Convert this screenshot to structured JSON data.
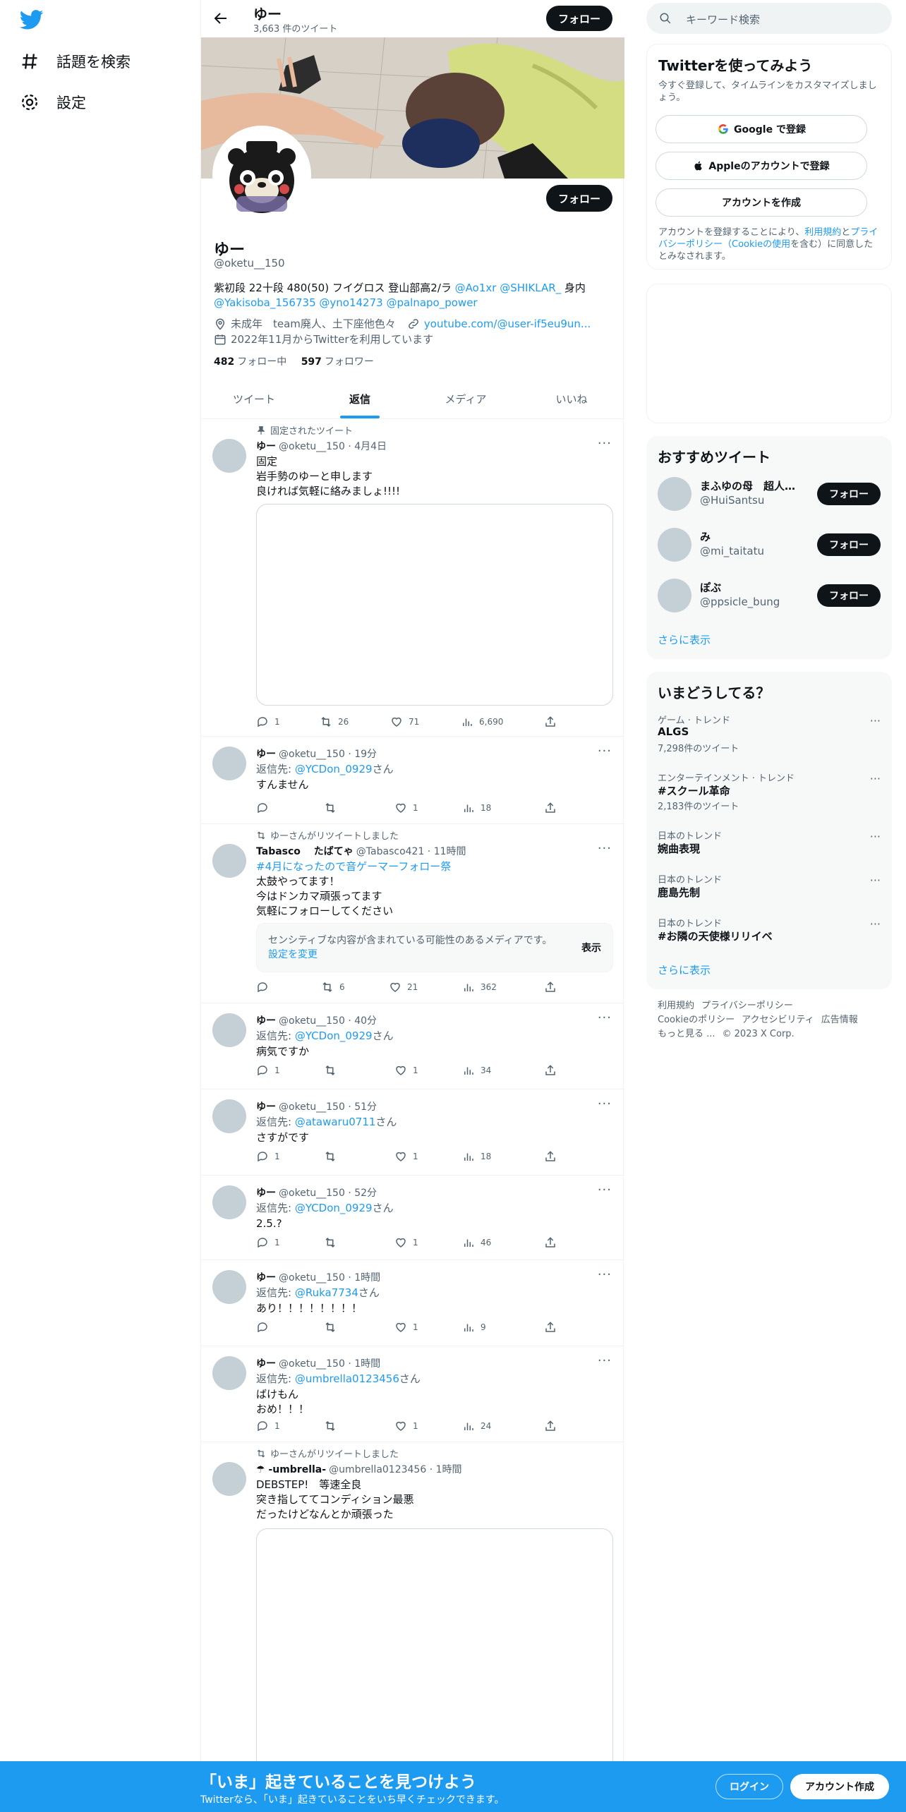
{
  "colors": {
    "accent": "#1d9bf0",
    "dark": "#0f1419",
    "muted": "#536471"
  },
  "nav": {
    "explore": "話題を検索",
    "settings": "設定"
  },
  "header": {
    "name": "ゆー",
    "tweet_count": "3,663 件のツイート",
    "follow": "フォロー"
  },
  "profile": {
    "follow": "フォロー",
    "name": "ゆー",
    "handle": "@oketu__150",
    "bio_line1_text": "紫初段 22十段 480(50) フイグロス 登山部高2/ラ ",
    "bio_link1": "@Ao1xr",
    "bio_link2": "@SHIKLAR_",
    "bio_line1_tail": " 身内",
    "bio_link3": "@Yakisoba_156735",
    "bio_link4": "@yno14273",
    "bio_link5": "@palnapo_power",
    "location": "未成年　team廃人、土下座他色々",
    "url": "youtube.com/@user-if5eu9un...",
    "joined": "2022年11月からTwitterを利用しています",
    "following_count": "482",
    "following_label": "フォロー中",
    "followers_count": "597",
    "followers_label": "フォロワー"
  },
  "tabs": [
    "ツイート",
    "返信",
    "メディア",
    "いいね"
  ],
  "tweets": [
    {
      "context": "固定されたツイート",
      "name": "ゆー",
      "meta": "@oketu__150 · 4月4日",
      "text": "固定\n岩手勢のゆーと申します\n良ければ気軽に絡みましょ!!!!",
      "reply": "1",
      "rt": "26",
      "like": "71",
      "views": "6,690"
    },
    {
      "name": "ゆー",
      "meta": "@oketu__150 · 19分",
      "reply_prefix": "返信先: ",
      "reply_to": "@YCDon_0929",
      "reply_suffix": "さん",
      "text": "すんません",
      "reply": "",
      "rt": "",
      "like": "1",
      "views": "18"
    },
    {
      "context": "ゆーさんがリツイートしました",
      "name": "Tabasco　 たばてゃ",
      "meta": "@Tabasco421 · 11時間",
      "hashtag": "#4月になったので音ゲーマーフォロー祭",
      "text": "太鼓やってます！\n今はドンカマ頑張ってます\n気軽にフォローしてください",
      "sensitive": "センシティブな内容が含まれている可能性のあるメディアです。",
      "sensitive_link": "設定を変更",
      "show": "表示",
      "reply": "",
      "rt": "6",
      "like": "21",
      "views": "362"
    },
    {
      "name": "ゆー",
      "meta": "@oketu__150 · 40分",
      "reply_prefix": "返信先: ",
      "reply_to": "@YCDon_0929",
      "reply_suffix": "さん",
      "text": "病気ですか",
      "reply": "1",
      "rt": "",
      "like": "1",
      "views": "34"
    },
    {
      "name": "ゆー",
      "meta": "@oketu__150 · 51分",
      "reply_prefix": "返信先: ",
      "reply_to": "@atawaru0711",
      "reply_suffix": "さん",
      "text": "さすがです",
      "reply": "1",
      "rt": "",
      "like": "1",
      "views": "18"
    },
    {
      "name": "ゆー",
      "meta": "@oketu__150 · 52分",
      "reply_prefix": "返信先: ",
      "reply_to": "@YCDon_0929",
      "reply_suffix": "さん",
      "text": "2.5.?",
      "reply": "1",
      "rt": "",
      "like": "1",
      "views": "46"
    },
    {
      "name": "ゆー",
      "meta": "@oketu__150 · 1時間",
      "reply_prefix": "返信先: ",
      "reply_to": "@Ruka7734",
      "reply_suffix": "さん",
      "text": "あり！！！！！！！！",
      "reply": "",
      "rt": "",
      "like": "1",
      "views": "9"
    },
    {
      "name": "ゆー",
      "meta": "@oketu__150 · 1時間",
      "reply_prefix": "返信先: ",
      "reply_to": "@umbrella0123456",
      "reply_suffix": "さん",
      "text": "ばけもん\nおめ！！！",
      "reply": "1",
      "rt": "",
      "like": "1",
      "views": "24"
    },
    {
      "context": "ゆーさんがリツイートしました",
      "name": "☂ -umbrella-",
      "meta": "@umbrella0123456 · 1時間",
      "text": "DEBSTEP!　等速全良\n突き指しててコンディション最悪\nだったけどなんとか頑張った"
    }
  ],
  "search": {
    "placeholder": "キーワード検索"
  },
  "signup_card": {
    "title": "Twitterを使ってみよう",
    "sub": "今すぐ登録して、タイムラインをカスタマイズしましょう。",
    "google": "Google で登録",
    "apple": "Appleのアカウントで登録",
    "create": "アカウントを作成",
    "legal_pre": "アカウントを登録することにより、",
    "legal_terms": "利用規約",
    "legal_mid": "と",
    "legal_privacy": "プライバシーポリシー（Cookieの使用",
    "legal_post": "を含む）に同意したとみなされます。"
  },
  "recommend": {
    "title": "おすすめツイート",
    "users": [
      {
        "name": "まふゆの母　超人理...",
        "handle": "@HuiSantsu"
      },
      {
        "name": "み",
        "handle": "@mi_taitatu"
      },
      {
        "name": "ぽぶ",
        "handle": "@ppsicle_bung"
      }
    ],
    "follow": "フォロー",
    "more": "さらに表示"
  },
  "trends": {
    "title": "いまどうしてる？",
    "items": [
      {
        "cat": "ゲーム · トレンド",
        "name": "ALGS",
        "count": "7,298件のツイート"
      },
      {
        "cat": "エンターテインメント · トレンド",
        "name": "#スクール革命",
        "count": "2,183件のツイート"
      },
      {
        "cat": "日本のトレンド",
        "name": "婉曲表現",
        "count": ""
      },
      {
        "cat": "日本のトレンド",
        "name": "鹿島先制",
        "count": ""
      },
      {
        "cat": "日本のトレンド",
        "name": "#お隣の天使様リリイベ",
        "count": ""
      }
    ],
    "more": "さらに表示"
  },
  "footer": {
    "terms": "利用規約",
    "privacy": "プライバシーポリシー",
    "cookie": "Cookieのポリシー",
    "access": "アクセシビリティ",
    "ads": "広告情報",
    "more": "もっと見る ...",
    "copy": "© 2023 X Corp."
  },
  "bottom": {
    "title": "「いま」起きていることを見つけよう",
    "sub": "Twitterなら、「いま」起きていることをいち早くチェックできます。",
    "login": "ログイン",
    "signup": "アカウント作成"
  }
}
